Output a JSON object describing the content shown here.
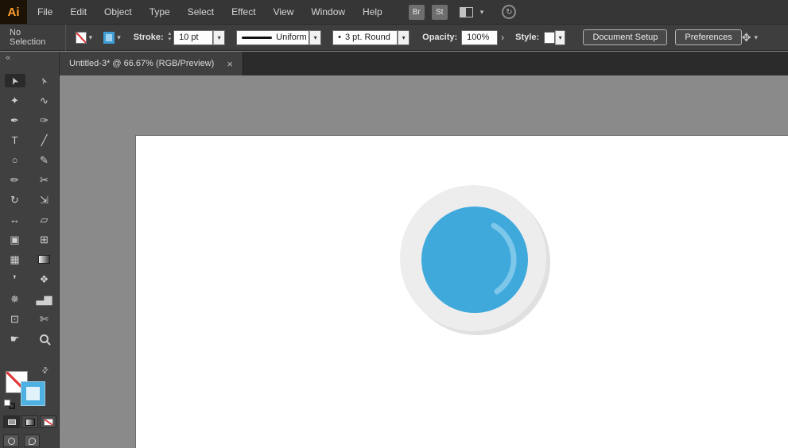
{
  "app": {
    "logo_text": "Ai"
  },
  "menubar": {
    "items": [
      "File",
      "Edit",
      "Object",
      "Type",
      "Select",
      "Effect",
      "View",
      "Window",
      "Help"
    ],
    "bridge_button": "Br",
    "stock_button": "St"
  },
  "icons": {
    "chevron_down": "▾",
    "step_up": "▴",
    "step_down": "▾",
    "flyout_arrow": "›",
    "collapse_left": "«",
    "swap_arrows": "⇄",
    "sync": "↻",
    "transform_icon": "✥"
  },
  "controlbar": {
    "selection_status": "No Selection",
    "stroke_label": "Stroke:",
    "stroke_weight": "10 pt",
    "width_profile": "Uniform",
    "brush_dot": "•",
    "brush_name": "3 pt. Round",
    "opacity_label": "Opacity:",
    "opacity_value": "100%",
    "style_label": "Style:",
    "document_setup_button": "Document Setup",
    "preferences_button": "Preferences"
  },
  "document_tab": {
    "title": "Untitled-3* @ 66.67% (RGB/Preview)",
    "close": "×"
  },
  "toolbar": {
    "tools": [
      {
        "name": "selection",
        "glyph": "➤"
      },
      {
        "name": "direct-selection",
        "glyph": "➢"
      },
      {
        "name": "magic-wand",
        "glyph": "✦"
      },
      {
        "name": "lasso",
        "glyph": "∿"
      },
      {
        "name": "pen",
        "glyph": "✒"
      },
      {
        "name": "curvature",
        "glyph": "✑"
      },
      {
        "name": "type",
        "glyph": "T"
      },
      {
        "name": "line-segment",
        "glyph": "╱"
      },
      {
        "name": "ellipse",
        "glyph": "○"
      },
      {
        "name": "paintbrush",
        "glyph": "✎"
      },
      {
        "name": "pencil",
        "glyph": "✏"
      },
      {
        "name": "scissors",
        "glyph": "✂"
      },
      {
        "name": "rotate",
        "glyph": "↻"
      },
      {
        "name": "scale",
        "glyph": "⇲"
      },
      {
        "name": "width",
        "glyph": "↔"
      },
      {
        "name": "free-transform",
        "glyph": "▱"
      },
      {
        "name": "shape-builder",
        "glyph": "▣"
      },
      {
        "name": "perspective-grid",
        "glyph": "⊞"
      },
      {
        "name": "mesh",
        "glyph": "▦"
      },
      {
        "name": "gradient",
        "glyph": ""
      },
      {
        "name": "eyedropper",
        "glyph": "❜"
      },
      {
        "name": "blend",
        "glyph": "❖"
      },
      {
        "name": "symbol-sprayer",
        "glyph": "✵"
      },
      {
        "name": "column-graph",
        "glyph": "▃▆"
      },
      {
        "name": "artboard",
        "glyph": "⊡"
      },
      {
        "name": "slice",
        "glyph": "✄"
      },
      {
        "name": "hand",
        "glyph": "☛"
      },
      {
        "name": "zoom",
        "glyph": ""
      }
    ]
  },
  "colors": {
    "accent_blue": "#3fa9dc",
    "highlight_blue": "#7cc7ea",
    "ring_gray": "#ededed",
    "ring_shadow": "#e0e0e0",
    "canvas_gray": "#8a8a8a",
    "artboard_white": "#ffffff",
    "ui_dark": "#3e3e3e",
    "logo_orange": "#ff9f2e",
    "none_red": "#e03a3a"
  },
  "artwork": {
    "ring_color": "#ededed",
    "shadow_color": "#e0e0e0",
    "circle_color": "#3fa9dc",
    "highlight_color": "#7cc7ea"
  }
}
